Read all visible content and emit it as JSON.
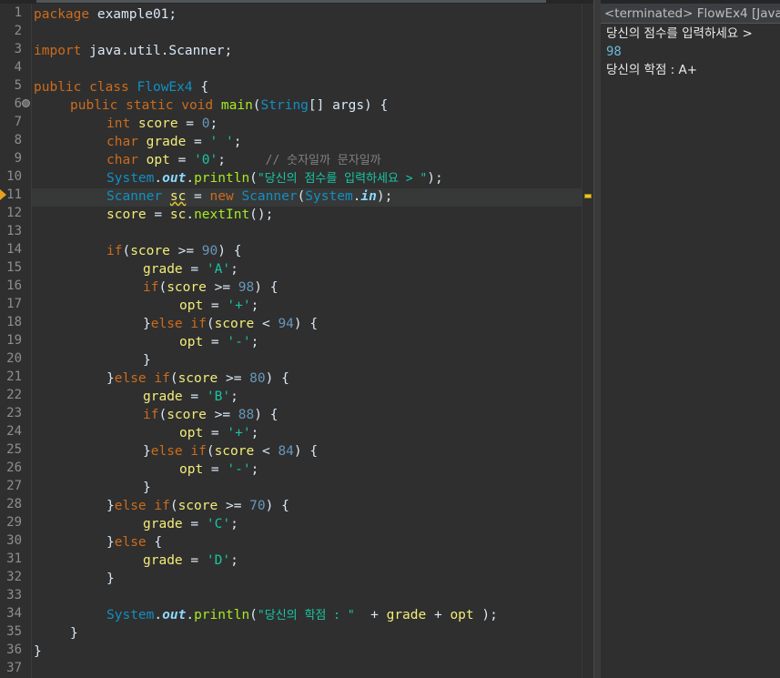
{
  "editor": {
    "line_numbers": [
      "1",
      "2",
      "3",
      "4",
      "5",
      "6",
      "7",
      "8",
      "9",
      "10",
      "11",
      "12",
      "13",
      "14",
      "15",
      "16",
      "17",
      "18",
      "19",
      "20",
      "21",
      "22",
      "23",
      "24",
      "25",
      "26",
      "27",
      "28",
      "29",
      "30",
      "31",
      "32",
      "33",
      "34",
      "35",
      "36",
      "37"
    ],
    "lines": {
      "l1_kw": "package",
      "l1_rest": " example01;",
      "l3_kw": "import",
      "l3_rest": " java.util.Scanner;",
      "l5_kw1": "public",
      "l5_kw2": " class ",
      "l5_cls": "FlowEx4",
      "l5_rest": " {",
      "l6_kw": "public static void ",
      "l6_mth": "main",
      "l6_p1": "(",
      "l6_cls": "String",
      "l6_p2": "[] ",
      "l6_arg": "args",
      "l6_rest": ") {",
      "l7_kw": "int ",
      "l7_var": "score",
      "l7_eq": " = ",
      "l7_num": "0",
      "l7_rest": ";",
      "l8_kw": "char ",
      "l8_var": "grade",
      "l8_eq": " = ",
      "l8_str": "' '",
      "l8_rest": ";",
      "l9_kw": "char ",
      "l9_var": "opt",
      "l9_eq": " = ",
      "l9_str": "'0'",
      "l9_rest": ";     ",
      "l9_cmt": "// 숫자일까 문자일까",
      "l10_cls": "System",
      "l10_dot": ".",
      "l10_fld": "out",
      "l10_dot2": ".",
      "l10_mth": "println",
      "l10_p": "(",
      "l10_str": "\"당신의 점수를 입력하세요 > \"",
      "l10_rest": ");",
      "l11_cls": "Scanner",
      "l11_sp": " ",
      "l11_var": "sc",
      "l11_eq": " = ",
      "l11_kw": "new",
      "l11_sp2": " ",
      "l11_cls2": "Scanner",
      "l11_p": "(",
      "l11_cls3": "System",
      "l11_dot": ".",
      "l11_fld": "in",
      "l11_rest": ");",
      "l12_var": "score",
      "l12_eq": " = ",
      "l12_var2": "sc",
      "l12_dot": ".",
      "l12_mth": "nextInt",
      "l12_rest": "();",
      "l14_kw": "if",
      "l14_p": "(",
      "l14_var": "score",
      "l14_op": " >= ",
      "l14_num": "90",
      "l14_rest": ") {",
      "l15_var": "grade",
      "l15_eq": " = ",
      "l15_str": "'A'",
      "l15_rest": ";",
      "l16_kw": "if",
      "l16_p": "(",
      "l16_var": "score",
      "l16_op": " >= ",
      "l16_num": "98",
      "l16_rest": ") {",
      "l17_var": "opt",
      "l17_eq": " = ",
      "l17_str": "'+'",
      "l17_rest": ";",
      "l18_b": "}",
      "l18_kw": "else if",
      "l18_p": "(",
      "l18_var": "score",
      "l18_op": " < ",
      "l18_num": "94",
      "l18_rest": ") {",
      "l19_var": "opt",
      "l19_eq": " = ",
      "l19_str": "'-'",
      "l19_rest": ";",
      "l20": "}",
      "l21_b": "}",
      "l21_kw": "else if",
      "l21_p": "(",
      "l21_var": "score",
      "l21_op": " >= ",
      "l21_num": "80",
      "l21_rest": ") {",
      "l22_var": "grade",
      "l22_eq": " = ",
      "l22_str": "'B'",
      "l22_rest": ";",
      "l23_kw": "if",
      "l23_p": "(",
      "l23_var": "score",
      "l23_op": " >= ",
      "l23_num": "88",
      "l23_rest": ") {",
      "l24_var": "opt",
      "l24_eq": " = ",
      "l24_str": "'+'",
      "l24_rest": ";",
      "l25_b": "}",
      "l25_kw": "else if",
      "l25_p": "(",
      "l25_var": "score",
      "l25_op": " < ",
      "l25_num": "84",
      "l25_rest": ") {",
      "l26_var": "opt",
      "l26_eq": " = ",
      "l26_str": "'-'",
      "l26_rest": ";",
      "l27": "}",
      "l28_b": "}",
      "l28_kw": "else if",
      "l28_p": "(",
      "l28_var": "score",
      "l28_op": " >= ",
      "l28_num": "70",
      "l28_rest": ") {",
      "l29_var": "grade",
      "l29_eq": " = ",
      "l29_str": "'C'",
      "l29_rest": ";",
      "l30_b": "}",
      "l30_kw": "else",
      "l30_rest": " {",
      "l31_var": "grade",
      "l31_eq": " = ",
      "l31_str": "'D'",
      "l31_rest": ";",
      "l32": "}",
      "l34_cls": "System",
      "l34_dot": ".",
      "l34_fld": "out",
      "l34_dot2": ".",
      "l34_mth": "println",
      "l34_p": "(",
      "l34_str": "\"당신의 학점 : \"",
      "l34_op": "  + ",
      "l34_var": "grade",
      "l34_op2": " + ",
      "l34_var2": "opt",
      "l34_rest": " );",
      "l35": "}",
      "l36": "}"
    }
  },
  "console": {
    "header": "<terminated> FlowEx4 [Java",
    "output": [
      "당신의 점수를 입력하세요 >",
      "98",
      "당신의 학점 : A+"
    ]
  },
  "colors": {
    "background": "#2f2f2f",
    "keyword": "#cc6c1d",
    "string": "#17c6a3",
    "number": "#6897bb",
    "class": "#1290c3",
    "method": "#a7ec21",
    "field": "#8dd8fd",
    "comment": "#808080",
    "variable": "#f3ec79",
    "plain": "#d9e8f7"
  }
}
